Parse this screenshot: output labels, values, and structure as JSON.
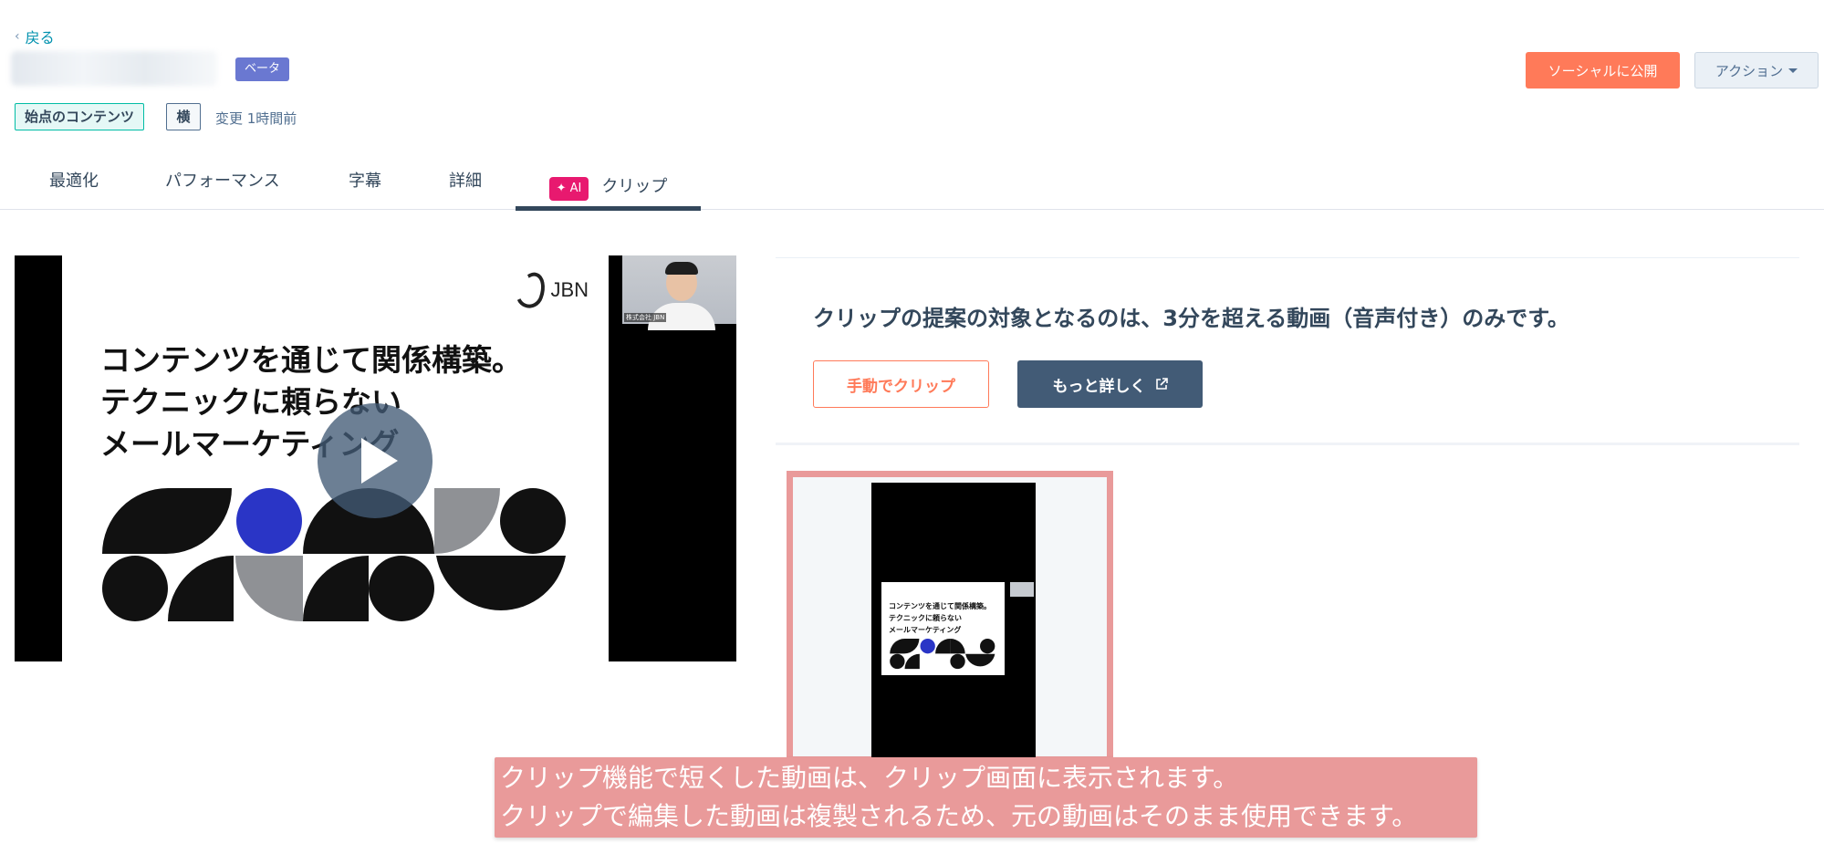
{
  "nav": {
    "back_label": "戻る"
  },
  "header": {
    "beta_badge": "ベータ",
    "tag_origin": "始点のコンテンツ",
    "tag_orientation": "横",
    "modified": "変更 1時間前",
    "publish_label": "ソーシャルに公開",
    "actions_label": "アクション"
  },
  "tabs": [
    {
      "label": "最適化"
    },
    {
      "label": "パフォーマンス"
    },
    {
      "label": "字幕"
    },
    {
      "label": "詳細"
    },
    {
      "label": "クリップ",
      "badge": "✦ AI",
      "active": true
    }
  ],
  "video": {
    "logo_text": "JBN",
    "headline_lines": [
      "コンテンツを通じて関係構築。",
      "テクニックに頼らない",
      "メールマーケティング"
    ],
    "webcam_label": "株式会社 JBN"
  },
  "clips": {
    "notice": "クリップの提案の対象となるのは、3分を超える動画（音声付き）のみです。",
    "manual_clip_label": "手動でクリップ",
    "learn_more_label": "もっと詳しく",
    "mini_headline_lines": [
      "コンテンツを通じて関係構築。",
      "テクニックに頼らない",
      "メールマーケティング"
    ]
  },
  "caption": {
    "line1": "クリップ機能で短くした動画は、クリップ画面に表示されます。",
    "line2": "クリップで編集した動画は複製されるため、元の動画はそのまま使用できます。"
  },
  "colors": {
    "accent": "#ff7a59",
    "dark_button": "#425b76",
    "beta": "#6a78d1",
    "ai_badge": "#e8196f",
    "caption_bg": "#e99a9a",
    "link": "#0091ae"
  }
}
